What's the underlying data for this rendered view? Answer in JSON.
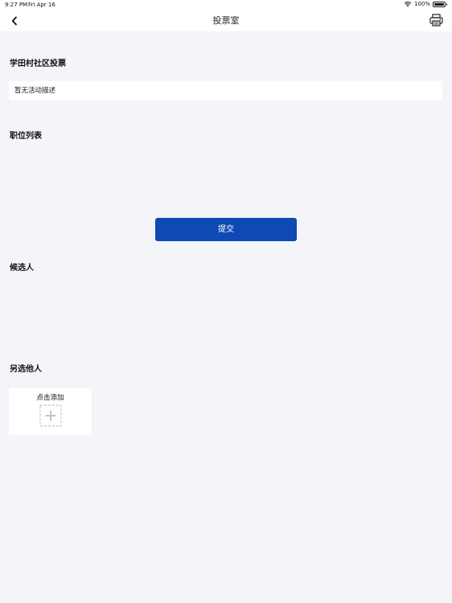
{
  "status_bar": {
    "time": "9:27 PM",
    "date": "Fri Apr 16",
    "battery": "100%"
  },
  "nav": {
    "title": "投票室",
    "back_icon": "chevron-left-icon",
    "print_icon": "printer-icon"
  },
  "activity": {
    "title": "学田村社区投票",
    "description": "暂无活动描述"
  },
  "positions": {
    "title": "职位列表"
  },
  "submit": {
    "label": "提交",
    "color": "#0f49b4"
  },
  "candidates": {
    "title": "候选人"
  },
  "others": {
    "title": "另选他人",
    "add_label": "点击添加",
    "add_icon": "plus-icon"
  }
}
